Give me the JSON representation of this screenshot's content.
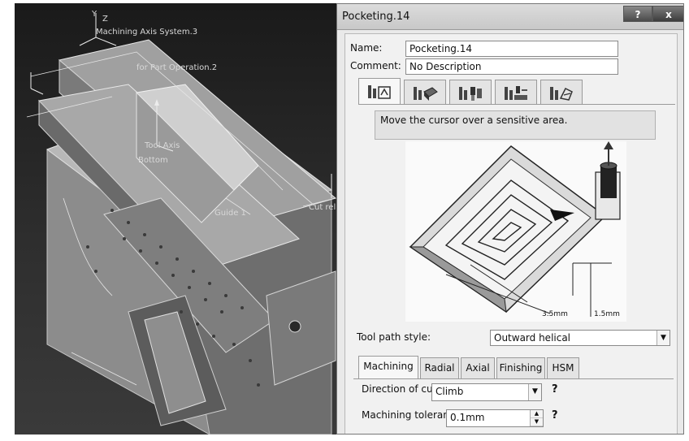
{
  "viewport": {
    "labels": {
      "axis_system": "Machining Axis System.3",
      "part_operation": "for Part Operation.2",
      "tool_axis": "Tool Axis",
      "bottom": "Bottom",
      "guide": "Guide 1",
      "axis_y": "Y",
      "axis_z": "Z",
      "side_label": "Cut rel"
    }
  },
  "dialog": {
    "title": "Pocketing.14",
    "help_glyph": "?",
    "close_glyph": "x",
    "name_label": "Name:",
    "name_value": "Pocketing.14",
    "comment_label": "Comment:",
    "comment_value": "No Description",
    "icon_tabs": [
      {
        "icon": "strategy-parameters-icon"
      },
      {
        "icon": "geometry-parameters-icon"
      },
      {
        "icon": "tool-parameters-icon"
      },
      {
        "icon": "feeds-speeds-icon"
      },
      {
        "icon": "macro-parameters-icon"
      }
    ],
    "hint": "Move the cursor over a sensitive area.",
    "diagram": {
      "dim_stepover": "3.5mm",
      "dim_depth": "1.5mm"
    },
    "tool_path_style_label": "Tool path style:",
    "tool_path_style_value": "Outward helical",
    "text_tabs": [
      "Machining",
      "Radial",
      "Axial",
      "Finishing",
      "HSM"
    ],
    "active_text_tab": "Machining",
    "direction_of_cut_label": "Direction of cut:",
    "direction_of_cut_value": "Climb",
    "machining_tolerance_label": "Machining tolerance:",
    "machining_tolerance_value": "0.1mm",
    "help_mark": "?"
  },
  "colors": {
    "dialog_bg": "#e9e9e9",
    "viewport_bg": "#2a2a2a",
    "part_face": "#b4b4b4",
    "tool_direction_arrow": "#5a5a5a"
  }
}
